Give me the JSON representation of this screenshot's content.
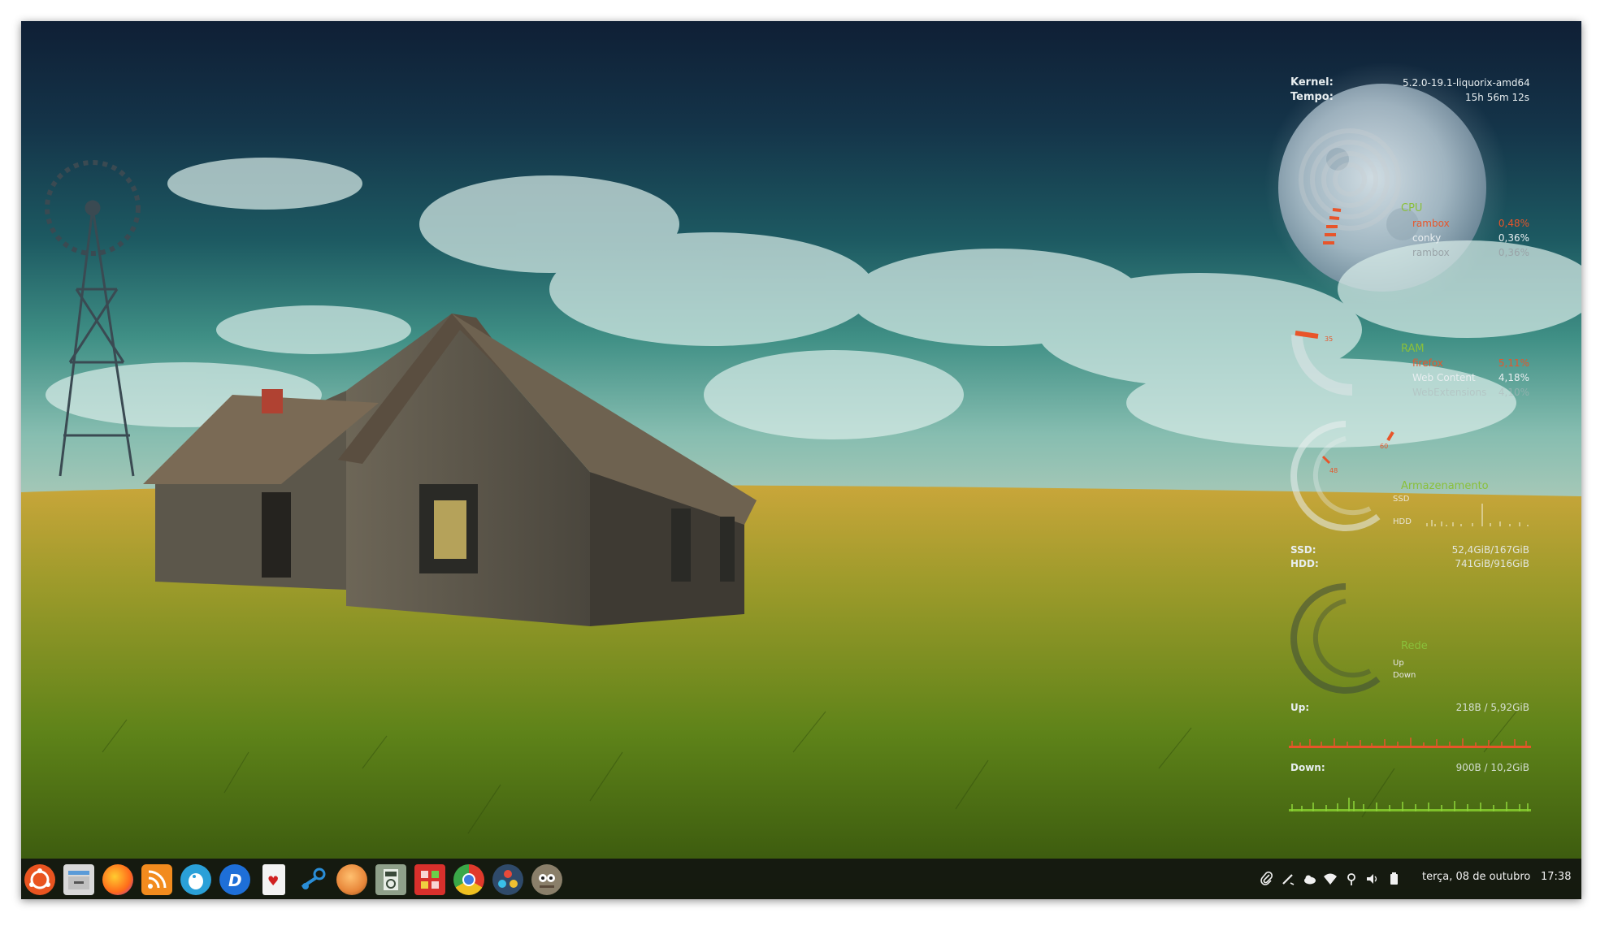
{
  "sysinfo": {
    "kernel_label": "Kernel:",
    "kernel_value": "5.2.0-19.1-liquorix-amd64",
    "uptime_label": "Tempo:",
    "uptime_value": "15h 56m 12s"
  },
  "cpu": {
    "title": "CPU",
    "processes": [
      {
        "name": "rambox",
        "value": "0,48%"
      },
      {
        "name": "conky",
        "value": "0,36%"
      },
      {
        "name": "rambox",
        "value": "0,36%"
      }
    ],
    "gauge_value": "35"
  },
  "ram": {
    "title": "RAM",
    "processes": [
      {
        "name": "firefox",
        "value": "5,11%"
      },
      {
        "name": "Web Content",
        "value": "4,18%"
      },
      {
        "name": "WebExtensions",
        "value": "4,10%"
      }
    ]
  },
  "storage": {
    "title": "Armazenamento",
    "ssd_short": "SSD",
    "hdd_short": "HDD",
    "gauge_ssd": "48",
    "gauge_hdd": "60",
    "ssd_label": "SSD:",
    "ssd_value": "52,4GiB/167GiB",
    "hdd_label": "HDD:",
    "hdd_value": "741GiB/916GiB"
  },
  "network": {
    "title": "Rede",
    "up_short": "Up",
    "down_short": "Down",
    "up_label": "Up:",
    "up_value": "218B  / 5,92GiB",
    "down_label": "Down:",
    "down_value": "900B  / 10,2GiB"
  },
  "taskbar": {
    "launchers": [
      {
        "name": "ubuntu-logo-icon",
        "color": "#e95420"
      },
      {
        "name": "files-icon",
        "color": "#d9d9d9"
      },
      {
        "name": "firefox-icon",
        "color": "#ff7a1a"
      },
      {
        "name": "rss-reader-icon",
        "color": "#f28b1e"
      },
      {
        "name": "telegram-like-icon",
        "color": "#2aa0d8"
      },
      {
        "name": "dash-app-icon",
        "color": "#1e6fd8"
      },
      {
        "name": "solitaire-cards-icon",
        "color": "#f3f3f3"
      },
      {
        "name": "steam-icon",
        "color": "#2a8ed8"
      },
      {
        "name": "orange-app-icon",
        "color": "#e8873a"
      },
      {
        "name": "calculator-icon",
        "color": "#8fa08a"
      },
      {
        "name": "red-grid-app-icon",
        "color": "#d8302c"
      },
      {
        "name": "chrome-like-icon",
        "color": "#3aa848"
      },
      {
        "name": "davinci-resolve-icon",
        "color": "#2f6fb3"
      },
      {
        "name": "gimp-icon",
        "color": "#8a7f6a"
      }
    ],
    "tray": [
      {
        "name": "paperclip-icon",
        "glyph": "⌀"
      },
      {
        "name": "pen-tool-icon",
        "glyph": "✎"
      },
      {
        "name": "weather-cloud-icon",
        "glyph": "☁"
      },
      {
        "name": "wifi-icon",
        "glyph": "▼"
      },
      {
        "name": "location-pin-icon",
        "glyph": "⚲"
      },
      {
        "name": "volume-icon",
        "glyph": "🔈"
      },
      {
        "name": "battery-icon",
        "glyph": "▮"
      }
    ],
    "date": "terça, 08 de outubro",
    "time": "17:38"
  }
}
